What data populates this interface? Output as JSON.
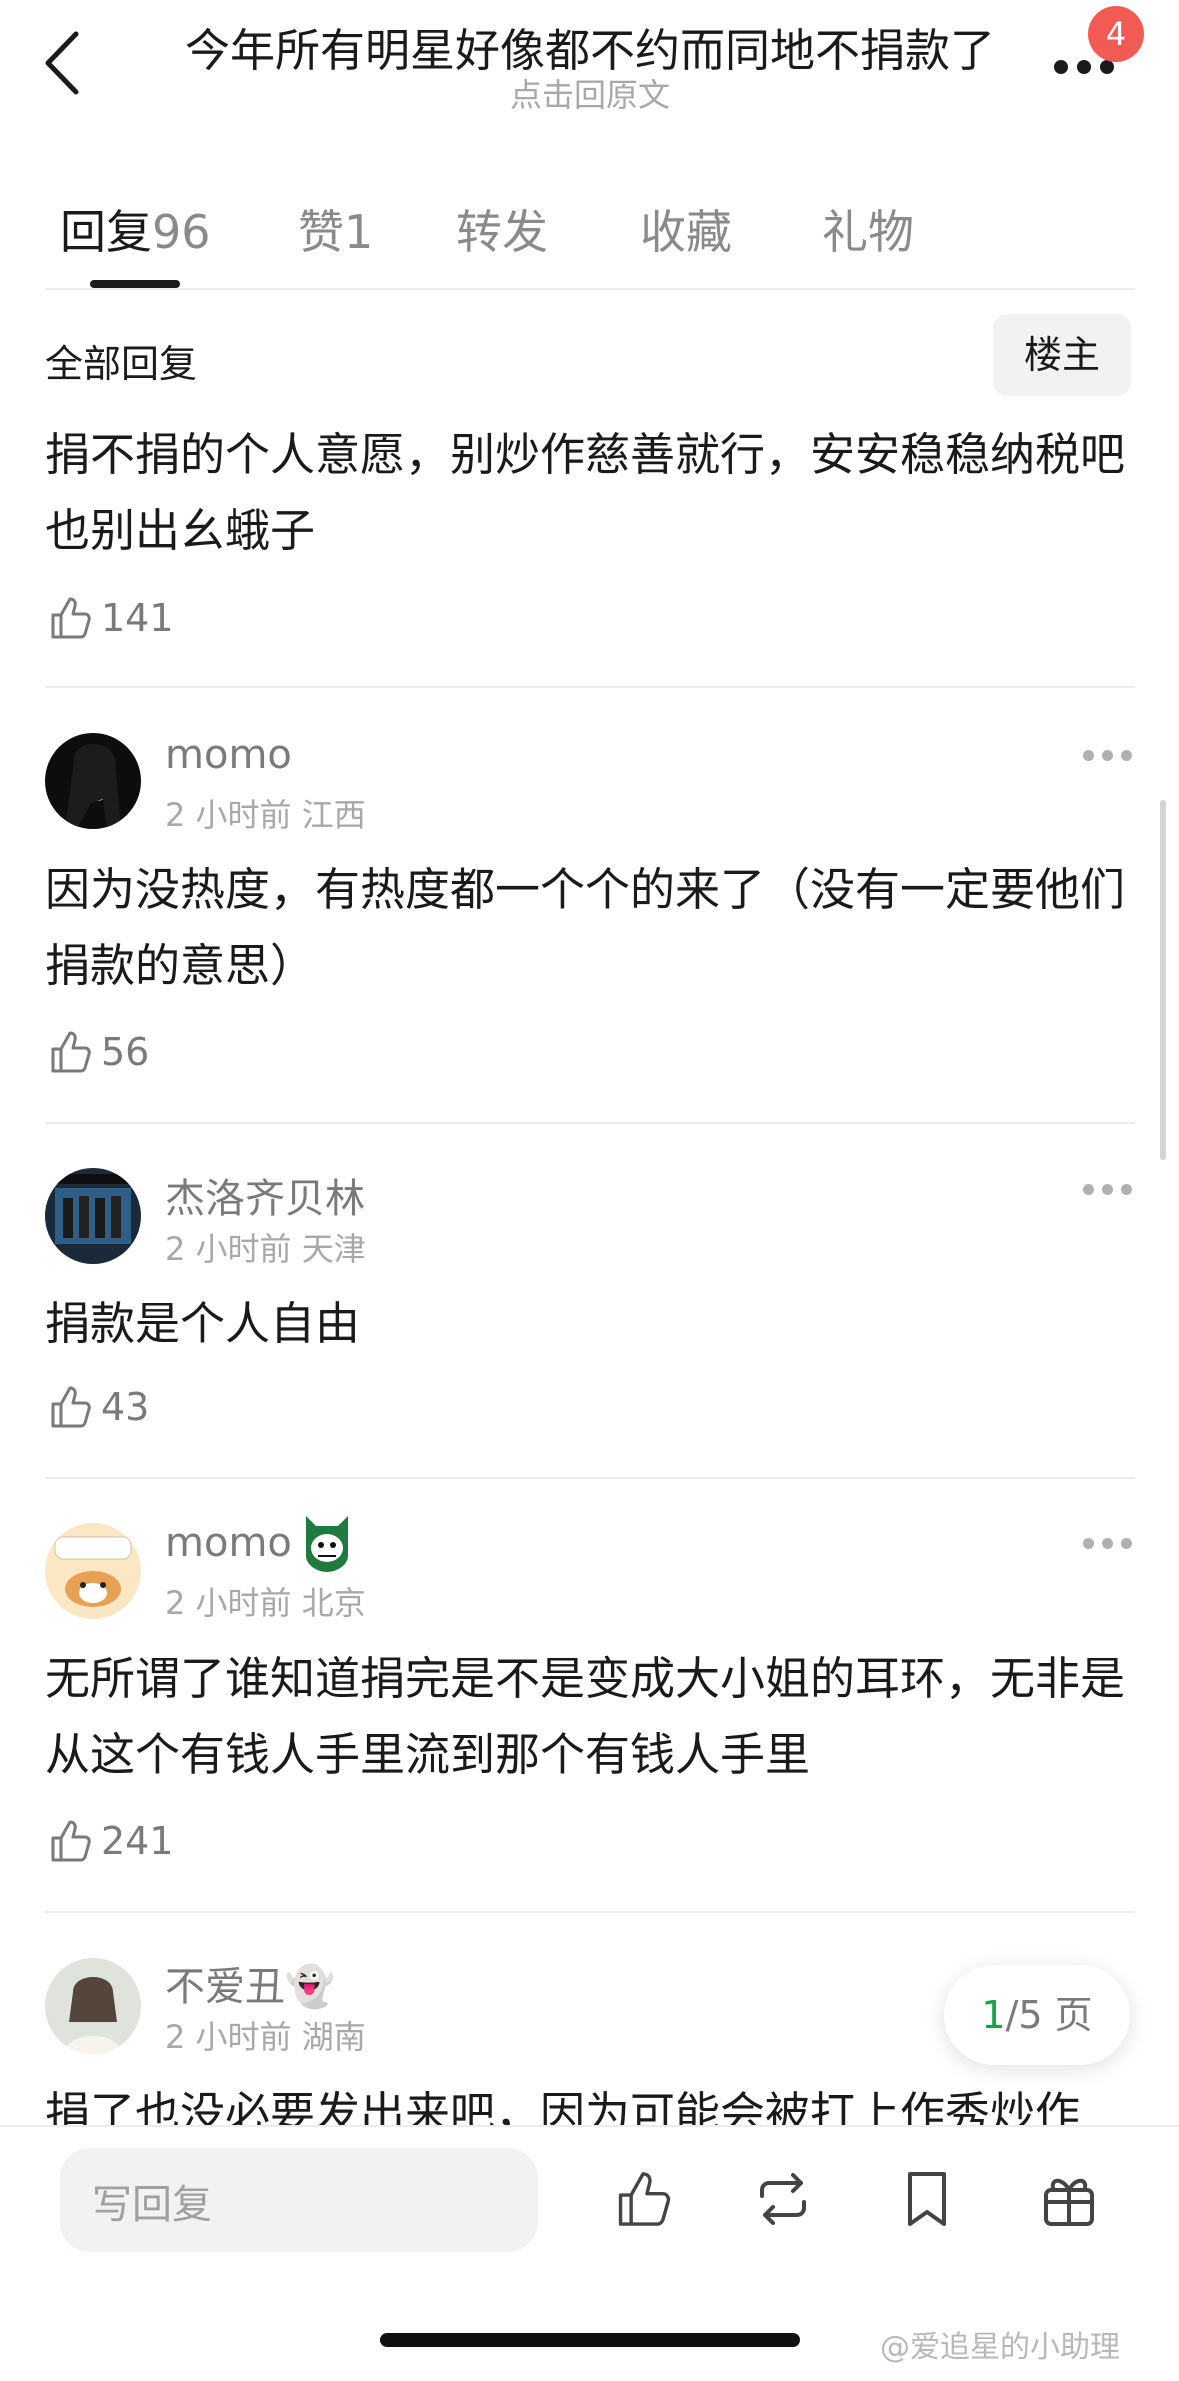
{
  "header": {
    "title": "今年所有明星好像都不约而同地不捐款了",
    "subtitle": "点击回原文",
    "badge_count": "4"
  },
  "tabs": [
    {
      "label": "回复",
      "count": "96"
    },
    {
      "label": "赞",
      "count": "1"
    },
    {
      "label": "转发",
      "count": ""
    },
    {
      "label": "收藏",
      "count": ""
    },
    {
      "label": "礼物",
      "count": ""
    }
  ],
  "section": {
    "title": "全部回复",
    "op_button": "楼主"
  },
  "op_comment": {
    "text": "捐不捐的个人意愿，别炒作慈善就行，安安稳稳纳税吧也别出幺蛾子",
    "likes": "141"
  },
  "comments": [
    {
      "username": "momo",
      "time": "2 小时前",
      "location": "江西",
      "text": "因为没热度，有热度都一个个的来了（没有一定要他们捐款的意思）",
      "likes": "56"
    },
    {
      "username": "杰洛齐贝林",
      "time": "2 小时前",
      "location": "天津",
      "text": "捐款是个人自由",
      "likes": "43"
    },
    {
      "username": "momo",
      "time": "2 小时前",
      "location": "北京",
      "text": "无所谓了谁知道捐完是不是变成大小姐的耳环，无非是从这个有钱人手里流到那个有钱人手里",
      "likes": "241"
    },
    {
      "username": "不爱丑👻",
      "time": "2 小时前",
      "location": "湖南",
      "text": "捐了也没必要发出来吧，因为可能会被打上作秀炒作",
      "likes": ""
    }
  ],
  "pagination": {
    "current": "1",
    "total_text": "/5 页"
  },
  "bottom_bar": {
    "reply_placeholder": "写回复"
  },
  "watermark": "@爱追星的小助理",
  "colors": {
    "badge": "#f25b54",
    "page_current": "#16a34a",
    "input_bg": "#f1f3f1"
  },
  "icons": [
    "back-icon",
    "more-icon",
    "thumb-up-icon",
    "comment-more-icon",
    "like-icon",
    "repost-icon",
    "bookmark-icon",
    "gift-icon"
  ]
}
